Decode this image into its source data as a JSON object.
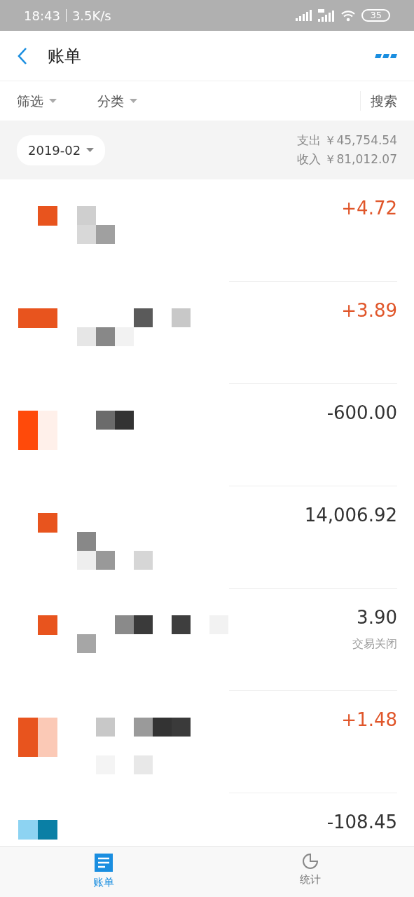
{
  "status_bar": {
    "time": "18:43",
    "speed": "3.5K/s",
    "battery": "35"
  },
  "header": {
    "title": "账单"
  },
  "filters": [
    {
      "label": "筛选",
      "dropdown": true
    },
    {
      "label": "分类",
      "dropdown": true
    },
    {
      "label": "搜索",
      "dropdown": false
    }
  ],
  "summary": {
    "month": "2019-02",
    "expense_label": "支出",
    "expense": "￥45,754.54",
    "income_label": "收入",
    "income": "￥81,012.07"
  },
  "transactions": [
    {
      "amount": "+4.72",
      "kind": "income"
    },
    {
      "amount": "+3.89",
      "kind": "income"
    },
    {
      "amount": "-600.00",
      "kind": "expense"
    },
    {
      "amount": "14,006.92",
      "kind": "other"
    },
    {
      "amount": "3.90",
      "kind": "other",
      "status": "交易关闭"
    },
    {
      "amount": "+1.48",
      "kind": "income"
    },
    {
      "amount": "-108.45",
      "kind": "expense"
    }
  ],
  "tabs": [
    {
      "label": "账单",
      "selected": true
    },
    {
      "label": "统计",
      "selected": false
    }
  ]
}
